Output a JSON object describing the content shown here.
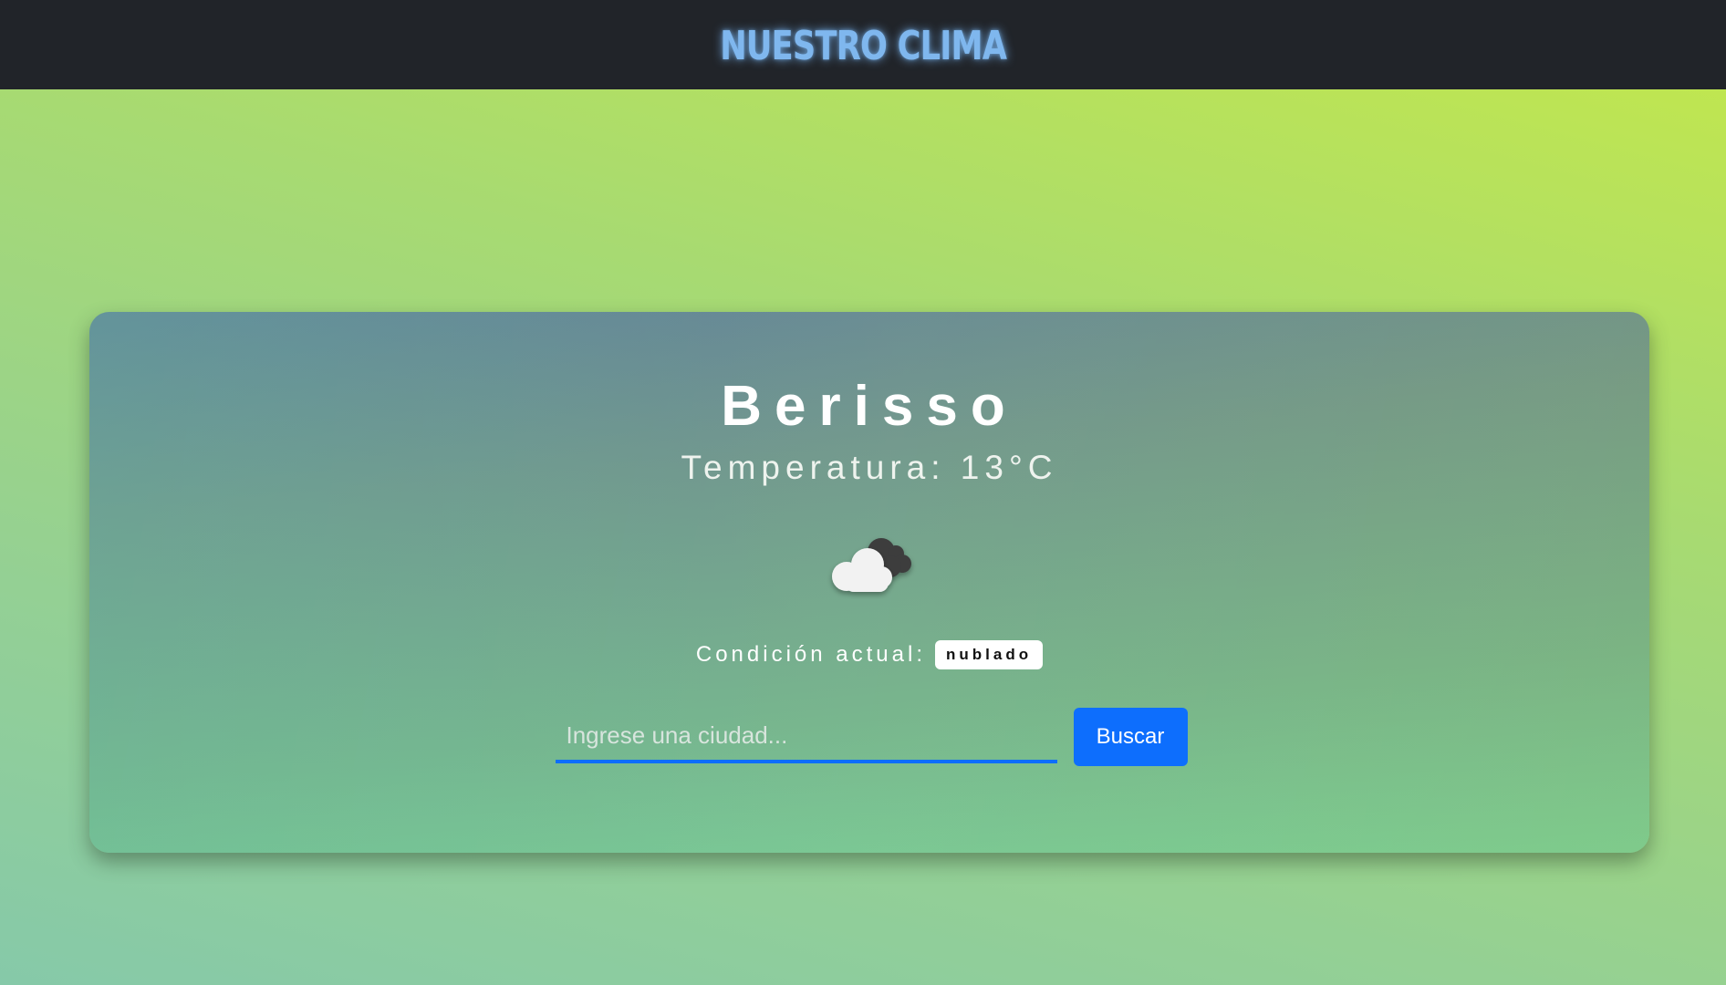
{
  "header": {
    "title": "NUESTRO CLIMA"
  },
  "weather": {
    "city": "Berisso",
    "temperature_text": "Temperatura: 13°C",
    "icon": "cloud-icon",
    "condition_label": "Condición actual:",
    "condition_value": "nublado"
  },
  "search": {
    "placeholder": "Ingrese una ciudad...",
    "value": "",
    "button_label": "Buscar"
  },
  "colors": {
    "navbar": "#212429",
    "brand": "#7fb7ee",
    "accent": "#0d6efd"
  }
}
